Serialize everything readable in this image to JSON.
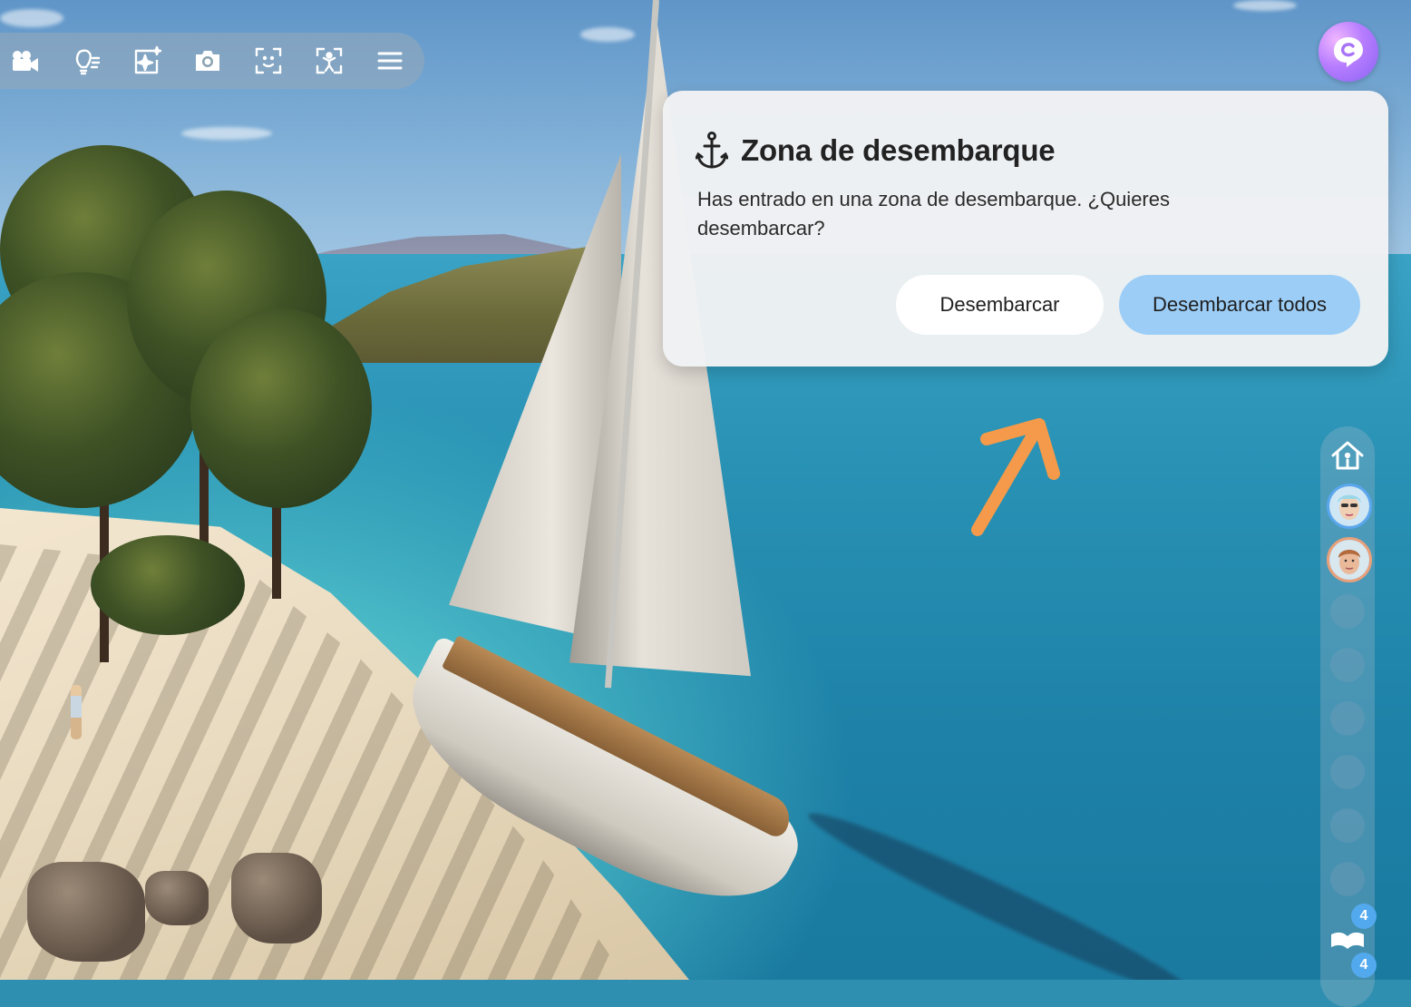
{
  "toolbar": {
    "items": [
      {
        "icon": "video-camera-icon"
      },
      {
        "icon": "lightbulb-icon"
      },
      {
        "icon": "ai-sparkle-icon"
      },
      {
        "icon": "camera-icon"
      },
      {
        "icon": "face-scan-icon"
      },
      {
        "icon": "body-scan-icon"
      },
      {
        "icon": "menu-icon"
      }
    ]
  },
  "profile": {
    "icon": "app-logo-icon"
  },
  "dialog": {
    "icon": "anchor-icon",
    "title": "Zona de desembarque",
    "message": "Has entrado en una zona de desembarque. ¿Quieres desembarcar?",
    "secondary_button": "Desembarcar",
    "primary_button": "Desembarcar todos"
  },
  "rail": {
    "home_icon": "home-icon",
    "players": [
      "player-avatar-1",
      "player-avatar-2"
    ],
    "badge_counts": [
      "4",
      "4"
    ],
    "book_icon": "book-icon"
  },
  "colors": {
    "primary_button": "#9ccdf6",
    "badge": "#53a9ee",
    "pointer_arrow": "#f59a4a",
    "profile_gradient_start": "#f0b6ff",
    "profile_gradient_end": "#8a63f2"
  }
}
